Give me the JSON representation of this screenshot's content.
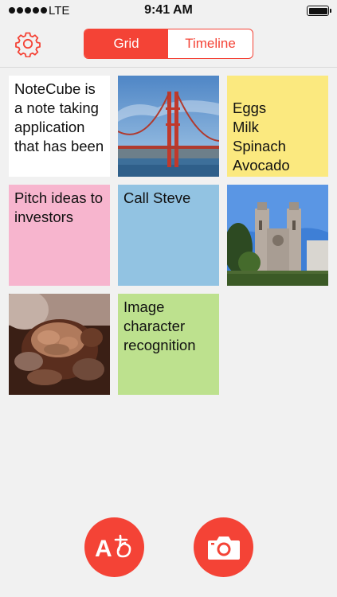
{
  "status_bar": {
    "carrier": "LTE",
    "time": "9:41 AM"
  },
  "nav": {
    "settings_icon": "gear-icon",
    "tabs": [
      {
        "label": "Grid",
        "active": true
      },
      {
        "label": "Timeline",
        "active": false
      }
    ]
  },
  "notes": [
    {
      "type": "text",
      "text": "NoteCube is a note taking application that has been",
      "color": "#ffffff"
    },
    {
      "type": "image",
      "subject": "Golden Gate Bridge photo"
    },
    {
      "type": "text",
      "text": "Eggs\nMilk\nSpinach\nAvocado\nTomatoes",
      "color": "#fbe97f"
    },
    {
      "type": "text",
      "text": "Pitch ideas to investors",
      "color": "#f7b5ce"
    },
    {
      "type": "text",
      "text": "Call Steve",
      "color": "#92c3e2"
    },
    {
      "type": "image",
      "subject": "cathedral photo"
    },
    {
      "type": "image",
      "subject": "chocolate ice cream photo"
    },
    {
      "type": "text",
      "text": "Image character recognition",
      "color": "#bde18e"
    }
  ],
  "actions": {
    "translate_icon": "translate-icon",
    "camera_icon": "camera-icon"
  },
  "colors": {
    "accent": "#f44336"
  }
}
